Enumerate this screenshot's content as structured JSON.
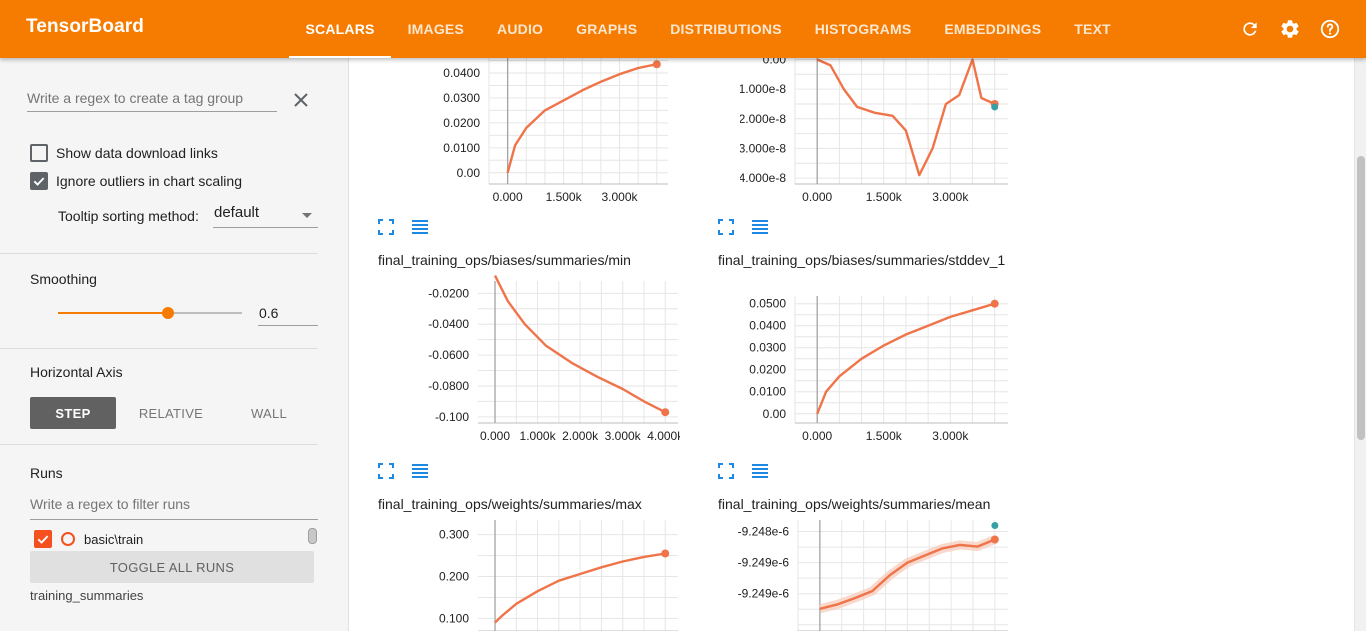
{
  "header": {
    "brand": "TensorBoard",
    "tabs": [
      "SCALARS",
      "IMAGES",
      "AUDIO",
      "GRAPHS",
      "DISTRIBUTIONS",
      "HISTOGRAMS",
      "EMBEDDINGS",
      "TEXT"
    ],
    "active_tab": "SCALARS",
    "icons": [
      "refresh-icon",
      "settings-icon",
      "help-icon"
    ]
  },
  "sidebar": {
    "tag_group_placeholder": "Write a regex to create a tag group",
    "show_download_links": {
      "label": "Show data download links",
      "checked": false
    },
    "ignore_outliers": {
      "label": "Ignore outliers in chart scaling",
      "checked": true
    },
    "tooltip_sorting_label": "Tooltip sorting method:",
    "tooltip_sorting_value": "default",
    "smoothing_title": "Smoothing",
    "smoothing_value": "0.6",
    "horizontal_axis_title": "Horizontal Axis",
    "axis_options": [
      "STEP",
      "RELATIVE",
      "WALL"
    ],
    "axis_selected": "STEP",
    "runs_title": "Runs",
    "runs_placeholder": "Write a regex to filter runs",
    "run_name": "basic\\train",
    "toggle_all_label": "TOGGLE ALL RUNS",
    "run_group_label": "training_summaries"
  },
  "colors": {
    "accent": "#f57c00",
    "run": "#f4511e",
    "line": "#f07449",
    "teal": "#36a0a6"
  },
  "chart_data": [
    {
      "type": "line",
      "title": "",
      "yticks": [
        "0.0400",
        "0.0300",
        "0.0200",
        "0.0100",
        "0.00"
      ],
      "xticks": [
        "0.000",
        "1.500k",
        "3.000k"
      ],
      "series": [
        {
          "values": [
            [
              0,
              0.0
            ],
            [
              200,
              0.011
            ],
            [
              500,
              0.018
            ],
            [
              1000,
              0.025
            ],
            [
              1500,
              0.029
            ],
            [
              2000,
              0.033
            ],
            [
              2500,
              0.0365
            ],
            [
              3000,
              0.0395
            ],
            [
              3500,
              0.042
            ],
            [
              4000,
              0.0435
            ]
          ]
        }
      ]
    },
    {
      "type": "line",
      "title": "",
      "yticks": [
        "0.00",
        "-1.000e-8",
        "-2.000e-8",
        "-3.000e-8",
        "-4.000e-8"
      ],
      "xticks": [
        "0.000",
        "1.500k",
        "3.000k"
      ],
      "series": [
        {
          "values": [
            [
              0,
              0.0
            ],
            [
              300,
              -2e-09
            ],
            [
              600,
              -1e-08
            ],
            [
              900,
              -1.6e-08
            ],
            [
              1300,
              -1.8e-08
            ],
            [
              1700,
              -1.9e-08
            ],
            [
              2000,
              -2.4e-08
            ],
            [
              2300,
              -3.9e-08
            ],
            [
              2600,
              -3e-08
            ],
            [
              2900,
              -1.5e-08
            ],
            [
              3200,
              -1.2e-08
            ],
            [
              3500,
              0.0
            ],
            [
              3700,
              -1.3e-08
            ],
            [
              4000,
              -1.5e-08
            ]
          ]
        }
      ]
    },
    {
      "type": "line",
      "title": "final_training_ops/biases/summaries/min",
      "yticks": [
        "-0.0200",
        "-0.0400",
        "-0.0600",
        "-0.0800",
        "-0.100"
      ],
      "xticks": [
        "0.000",
        "1.000k",
        "2.000k",
        "3.000k",
        "4.000k"
      ],
      "series": [
        {
          "values": [
            [
              0,
              -0.0085
            ],
            [
              300,
              -0.025
            ],
            [
              700,
              -0.04
            ],
            [
              1200,
              -0.054
            ],
            [
              1800,
              -0.065
            ],
            [
              2400,
              -0.074
            ],
            [
              3000,
              -0.082
            ],
            [
              3500,
              -0.09
            ],
            [
              4000,
              -0.097
            ]
          ]
        }
      ]
    },
    {
      "type": "line",
      "title": "final_training_ops/biases/summaries/stddev_1",
      "yticks": [
        "0.0500",
        "0.0400",
        "0.0300",
        "0.0200",
        "0.0100",
        "0.00"
      ],
      "xticks": [
        "0.000",
        "1.500k",
        "3.000k"
      ],
      "series": [
        {
          "values": [
            [
              0,
              0.0
            ],
            [
              200,
              0.01
            ],
            [
              500,
              0.017
            ],
            [
              1000,
              0.025
            ],
            [
              1500,
              0.031
            ],
            [
              2000,
              0.036
            ],
            [
              2500,
              0.04
            ],
            [
              3000,
              0.044
            ],
            [
              3500,
              0.047
            ],
            [
              4000,
              0.05
            ]
          ]
        }
      ]
    },
    {
      "type": "line",
      "title": "final_training_ops/weights/summaries/max",
      "yticks": [
        "0.300",
        "0.200",
        "0.100"
      ],
      "xticks": [],
      "series": [
        {
          "values": [
            [
              0,
              0.09
            ],
            [
              150,
              0.105
            ],
            [
              500,
              0.135
            ],
            [
              1000,
              0.165
            ],
            [
              1500,
              0.19
            ],
            [
              2000,
              0.206
            ],
            [
              2500,
              0.222
            ],
            [
              3000,
              0.236
            ],
            [
              3500,
              0.247
            ],
            [
              4000,
              0.255
            ]
          ]
        }
      ]
    },
    {
      "type": "line",
      "title": "final_training_ops/weights/summaries/mean",
      "yticks": [
        "-9.248e-6",
        "-9.249e-6",
        "-9.249e-6"
      ],
      "xticks": [],
      "series": [
        {
          "values": [
            [
              0,
              0.0
            ],
            [
              400,
              0.05
            ],
            [
              800,
              0.12
            ],
            [
              1200,
              0.2
            ],
            [
              1600,
              0.38
            ],
            [
              2000,
              0.52
            ],
            [
              2400,
              0.6
            ],
            [
              2800,
              0.68
            ],
            [
              3200,
              0.72
            ],
            [
              3600,
              0.7
            ],
            [
              4000,
              0.78
            ]
          ]
        }
      ]
    }
  ]
}
